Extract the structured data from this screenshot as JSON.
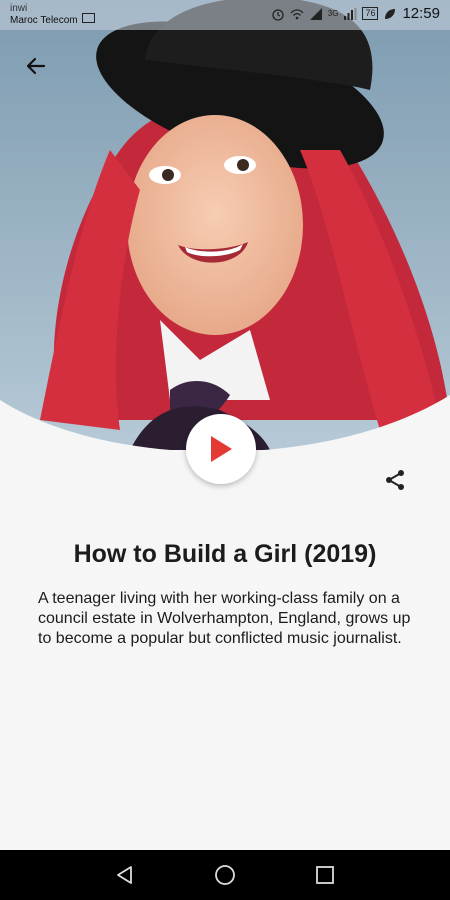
{
  "status_bar": {
    "carrier_line1": "inwi",
    "carrier_line2": "Maroc Telecom",
    "network": "3G",
    "battery": "76",
    "time": "12:59"
  },
  "movie": {
    "title": "How to Build a Girl (2019)",
    "description": "A teenager living with her working-class family on a council estate in Wolverhampton, England, grows up to become a popular but conflicted music journalist."
  },
  "icons": {
    "back": "arrow-back-icon",
    "play": "play-icon",
    "share": "share-icon",
    "nav_back": "triangle-back-icon",
    "nav_home": "circle-home-icon",
    "nav_recent": "square-recent-icon"
  },
  "colors": {
    "play_accent": "#e53935",
    "background": "#f6f6f6",
    "text": "#1c1c1c"
  }
}
